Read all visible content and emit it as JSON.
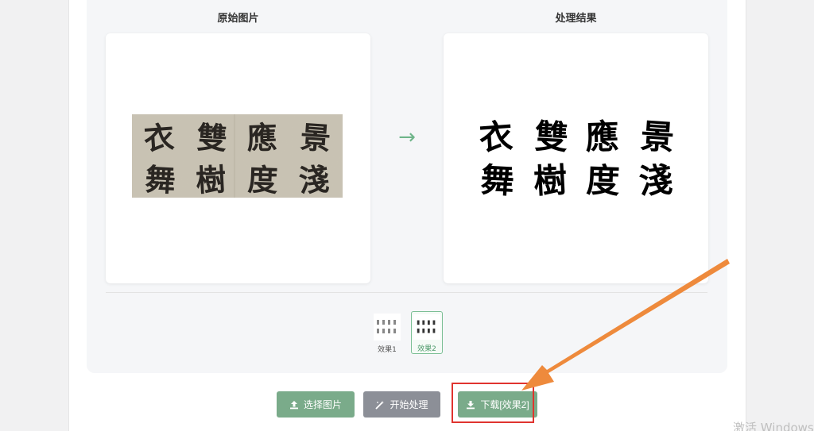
{
  "modal": {
    "close_label": "×"
  },
  "columns": {
    "original_title": "原始图片",
    "result_title": "处理结果",
    "arrow": "→"
  },
  "calligraphy": {
    "row1": [
      "衣",
      "雙",
      "應",
      "景"
    ],
    "row2": [
      "舞",
      "樹",
      "度",
      "淺"
    ]
  },
  "results": {
    "items": [
      {
        "label": "效果1",
        "active": false
      },
      {
        "label": "效果2",
        "active": true
      }
    ]
  },
  "actions": {
    "select_label": "选择图片",
    "process_label": "开始处理",
    "download_label": "下载[效果2]"
  },
  "watermark": "激活 Windows",
  "colors": {
    "primary_green": "#7aab8a",
    "gray_button": "#8c8f97",
    "highlight_red": "#e0342f",
    "arrow_orange": "#ee8a3c"
  }
}
